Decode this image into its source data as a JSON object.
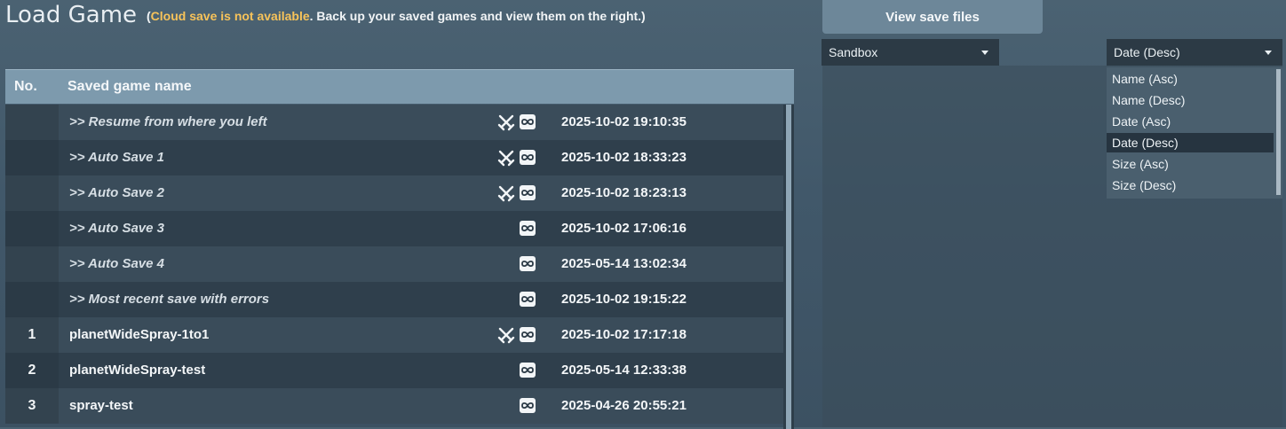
{
  "header": {
    "title": "Load Game",
    "notice_open": "(",
    "notice_warning": "Cloud save is not available",
    "notice_rest": ". Back up your saved games and view them on the right.)"
  },
  "table": {
    "col_no": "No.",
    "col_name": "Saved game name",
    "rows": [
      {
        "no": "",
        "name": ">> Resume from where you left",
        "date": "2025-10-02 19:10:35",
        "icons": [
          "swords-icon",
          "infinity-icon"
        ]
      },
      {
        "no": "",
        "name": ">> Auto Save 1",
        "date": "2025-10-02 18:33:23",
        "icons": [
          "swords-icon",
          "infinity-icon"
        ]
      },
      {
        "no": "",
        "name": ">> Auto Save 2",
        "date": "2025-10-02 18:23:13",
        "icons": [
          "swords-icon",
          "infinity-icon"
        ]
      },
      {
        "no": "",
        "name": ">> Auto Save 3",
        "date": "2025-10-02 17:06:16",
        "icons": [
          "infinity-icon"
        ]
      },
      {
        "no": "",
        "name": ">> Auto Save 4",
        "date": "2025-05-14 13:02:34",
        "icons": [
          "infinity-icon"
        ]
      },
      {
        "no": "",
        "name": ">> Most recent save with errors",
        "date": "2025-10-02 19:15:22",
        "icons": [
          "infinity-icon"
        ]
      },
      {
        "no": "1",
        "name": "planetWideSpray-1to1",
        "date": "2025-10-02 17:17:18",
        "icons": [
          "swords-icon",
          "infinity-icon"
        ]
      },
      {
        "no": "2",
        "name": "planetWideSpray-test",
        "date": "2025-05-14 12:33:38",
        "icons": [
          "infinity-icon"
        ]
      },
      {
        "no": "3",
        "name": "spray-test",
        "date": "2025-04-26 20:55:21",
        "icons": [
          "infinity-icon"
        ]
      }
    ]
  },
  "right_panel": {
    "tab_label": "View save files",
    "filter_value": "Sandbox",
    "sort_value": "Date (Desc)",
    "sort_options": [
      "Name (Asc)",
      "Name (Desc)",
      "Date (Asc)",
      "Date (Desc)",
      "Size (Asc)",
      "Size (Desc)"
    ],
    "sort_selected_index": 3
  },
  "colors": {
    "background": "#44596a",
    "header_bar": "#7d9aad",
    "warning_text": "#f7c35a",
    "selected_option": "#263440"
  }
}
